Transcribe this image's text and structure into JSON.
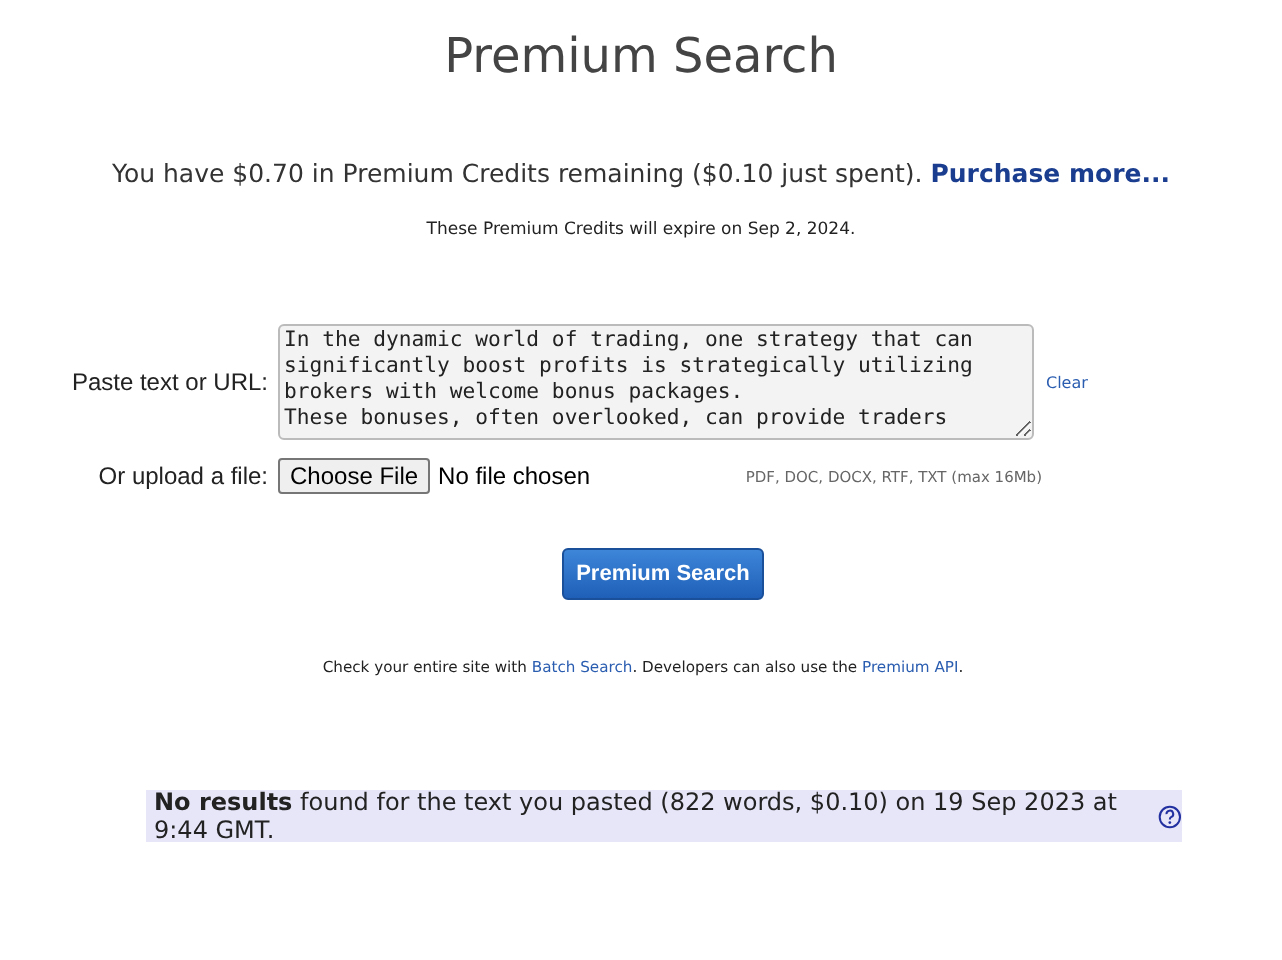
{
  "title": "Premium Search",
  "credits": {
    "text": "You have $0.70 in Premium Credits remaining ($0.10 just spent).",
    "link": "Purchase more..."
  },
  "expiry": "These Premium Credits will expire on Sep 2, 2024.",
  "paste": {
    "label": "Paste text or URL:",
    "value": "In the dynamic world of trading, one strategy that can significantly boost profits is strategically utilizing brokers with welcome bonus packages.\nThese bonuses, often overlooked, can provide traders",
    "clear": "Clear"
  },
  "upload": {
    "label": "Or upload a file:",
    "button": "Choose File",
    "status": "No file chosen",
    "hint": "PDF, DOC, DOCX, RTF, TXT (max 16Mb)"
  },
  "search_button": "Premium Search",
  "footer": [
    {
      "kind": "text",
      "text": "Check your entire site with "
    },
    {
      "kind": "link",
      "text": "Batch Search"
    },
    {
      "kind": "text",
      "text": ". Developers can also use the "
    },
    {
      "kind": "link",
      "text": "Premium API"
    },
    {
      "kind": "text",
      "text": "."
    }
  ],
  "result": {
    "text": "**No results** found for the text you pasted (822 words, $0.10) on 19 Sep 2023 at 9:44 GMT."
  }
}
